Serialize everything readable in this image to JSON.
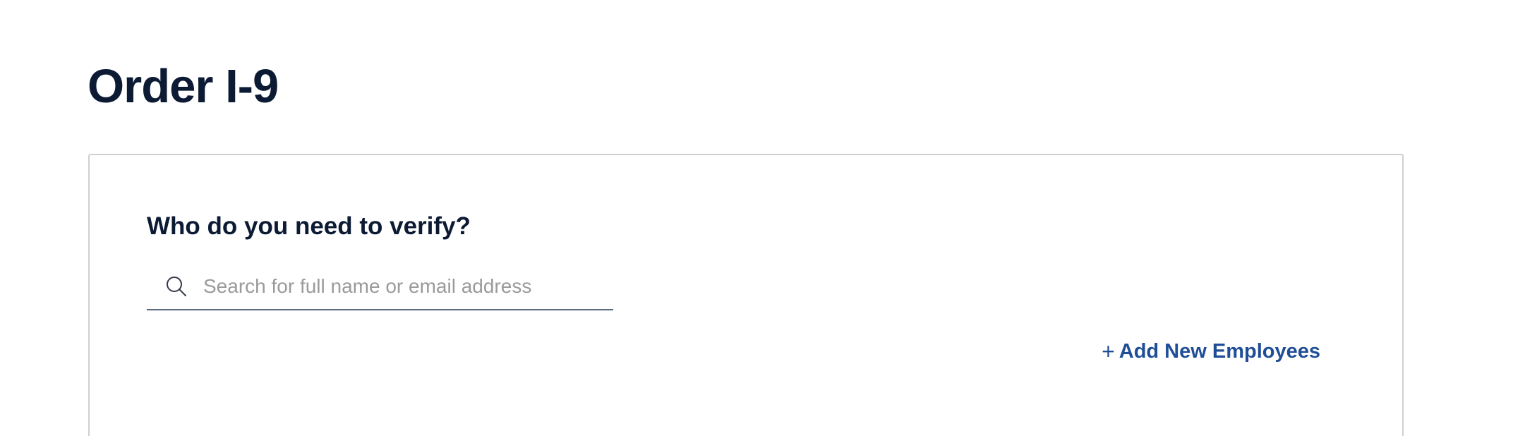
{
  "page": {
    "title": "Order I-9"
  },
  "verify_card": {
    "question": "Who do you need to verify?",
    "search": {
      "placeholder": "Search for full name or email address",
      "value": "",
      "icon": "search-icon"
    },
    "add_new": {
      "icon_glyph": "+",
      "icon": "plus-icon",
      "label": "Add New Employees"
    }
  },
  "colors": {
    "heading": "#0c1a33",
    "link": "#1f4e96",
    "placeholder": "#9a9a9a",
    "card_border": "#d0d0d0",
    "input_underline": "#5d6b80"
  }
}
